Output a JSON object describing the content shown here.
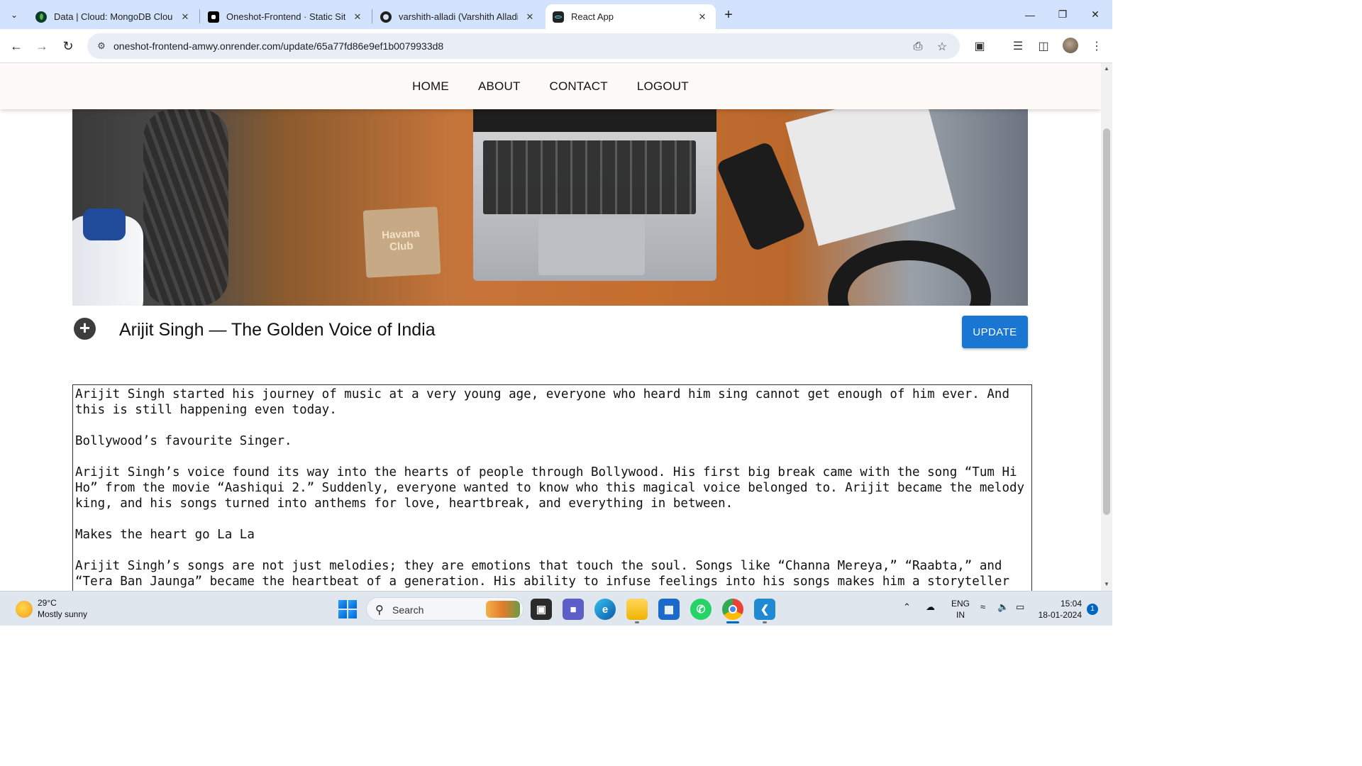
{
  "browser": {
    "tabs": [
      {
        "title": "Data | Cloud: MongoDB Cloud",
        "favicon": "mongodb-leaf-icon",
        "favicon_color": "#0b3d2e"
      },
      {
        "title": "Oneshot-Frontend · Static Site",
        "favicon": "render-icon",
        "favicon_color": "#000000"
      },
      {
        "title": "varshith-alladi (Varshith Alladi)",
        "favicon": "github-icon",
        "favicon_color": "#1f1f1f"
      },
      {
        "title": "React App",
        "favicon": "react-icon",
        "favicon_color": "#222222",
        "active": true
      }
    ],
    "url": "oneshot-frontend-amwy.onrender.com/update/65a77fd86e9ef1b0079933d8"
  },
  "site": {
    "nav": [
      "HOME",
      "ABOUT",
      "CONTACT",
      "LOGOUT"
    ],
    "hero_coaster_text": "Havana Club",
    "post_title": "Arijit Singh — The Golden Voice of India",
    "update_label": "UPDATE",
    "accent": "#1976d2",
    "content_paragraphs": [
      "Arijit Singh started his journey of music at a very young age, everyone who heard him sing cannot get enough of him ever. And this is still happening even today.",
      "Bollywood’s favourite Singer.",
      "Arijit Singh’s voice found its way into the hearts of people through Bollywood. His first big break came with the song “Tum Hi Ho” from the movie “Aashiqui 2.” Suddenly, everyone wanted to know who this magical voice belonged to. Arijit became the melody king, and his songs turned into anthems for love, heartbreak, and everything in between.",
      "Makes the heart go La La",
      "Arijit Singh’s songs are not just melodies; they are emotions that touch the soul. Songs like “Channa Mereya,” “Raabta,” and “Tera Ban Jaunga” became the heartbeat of a generation. His ability to infuse feelings into his songs makes him a storyteller through"
    ]
  },
  "taskbar": {
    "weather_temp": "29°C",
    "weather_desc": "Mostly sunny",
    "search_label": "Search",
    "lang_top": "ENG",
    "lang_bottom": "IN",
    "time": "15:04",
    "date": "18-01-2024",
    "notification_count": "1"
  }
}
